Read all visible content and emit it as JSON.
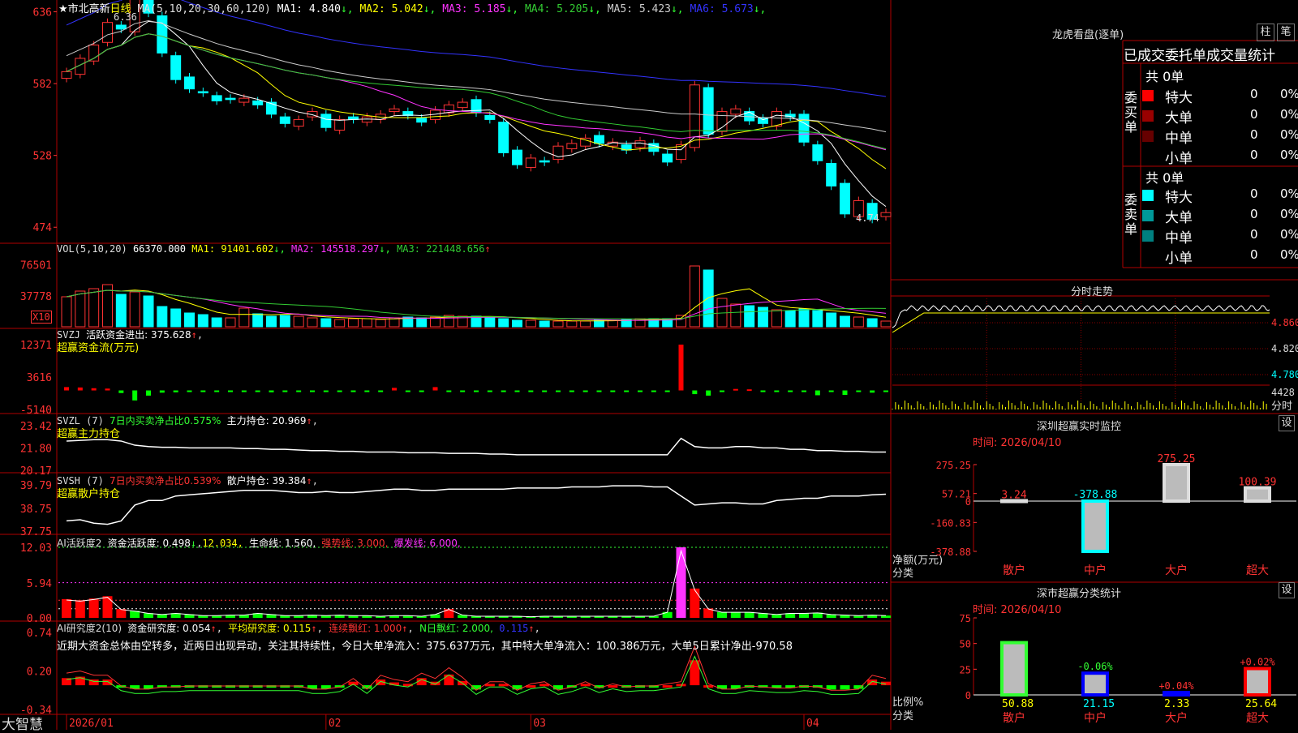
{
  "stock": {
    "title": "★市北高新",
    "period": "日线",
    "ma_label": "MA(5,10,20,30,60,120)",
    "ma": [
      {
        "name": "MA1:",
        "value": "4.840",
        "arrow": "↓",
        "color": "#ffffff"
      },
      {
        "name": "MA2:",
        "value": "5.042",
        "arrow": "↓",
        "color": "#ffff00"
      },
      {
        "name": "MA3:",
        "value": "5.185",
        "arrow": "↓",
        "color": "#ff33ff"
      },
      {
        "name": "MA4:",
        "value": "5.205",
        "arrow": "↓",
        "color": "#33cc33"
      },
      {
        "name": "MA5:",
        "value": "5.423",
        "arrow": "↓",
        "color": "#cccccc"
      },
      {
        "name": "MA6:",
        "value": "5.673",
        "arrow": "↓",
        "color": "#3333ff"
      }
    ],
    "high_label": "6.36",
    "low_label": "4.74",
    "y_ticks": [
      "636",
      "582",
      "528",
      "474"
    ],
    "x_labels": [
      "2026/01",
      "02",
      "03",
      "04"
    ],
    "brand": "大智慧"
  },
  "vol": {
    "label": "VOL(5,10,20)",
    "value": "66370.000",
    "items": [
      {
        "name": "MA1:",
        "value": "91401.602",
        "arrow": "↓",
        "color": "#ffff00"
      },
      {
        "name": "MA2:",
        "value": "145518.297",
        "arrow": "↓",
        "color": "#ff33ff"
      },
      {
        "name": "MA3:",
        "value": "221448.656",
        "arrow": "↑",
        "color": "#33cc33"
      }
    ],
    "y_ticks": [
      "76501",
      "37778"
    ],
    "unit": "X10"
  },
  "svzj": {
    "label": "SVZJ",
    "line1": "活跃资金进出: 375.628",
    "arrow": "↑",
    "line2": "超赢资金流(万元)",
    "y_ticks": [
      "12371",
      "3616",
      "-5140"
    ]
  },
  "svzl": {
    "label": "SVZL (7)",
    "text1": "7日内买卖净占比0.575%",
    "text2": "主力持仓: 20.969",
    "arrow": "↑",
    "line2": "超赢主力持仓",
    "y_ticks": [
      "23.42",
      "21.80",
      "20.17"
    ]
  },
  "svsh": {
    "label": "SVSH (7)",
    "text1": "7日内买卖净占比0.539%",
    "text2": "散户持仓: 39.384",
    "arrow": "↑",
    "line2": "超赢散户持仓",
    "y_ticks": [
      "39.79",
      "38.75",
      "37.75"
    ]
  },
  "ai1": {
    "label": "AI活跃度2",
    "t1": "资金活跃度: 0.498",
    "t2": "12.034,",
    "t3": "生命线: 1.560,",
    "t4": "强势线: 3.000,",
    "t5": "爆发线: 6.000,",
    "y_ticks": [
      "12.03",
      "5.94",
      "0.00"
    ]
  },
  "ai2": {
    "label": "AI研究度2(10)",
    "t1": "资金研究度: 0.054",
    "t2": "平均研究度: 0.115",
    "t3": "连续飘红: 1.000",
    "t4": "N日飘红: 2.000,",
    "t5": "0.115",
    "comment": "近期大资金总体由空转多，近两日出现异动，关注其持续性，今日大单净流入：375.637万元，其中特大单净流入：100.386万元，大单5日累计净出-970.58",
    "y_ticks": [
      "0.74",
      "0.20",
      "-0.34"
    ]
  },
  "dragon": {
    "title": "龙虎看盘(逐单)",
    "btn1": "柱",
    "btn2": "笔",
    "header": "已成交委托单成交量统计",
    "buy_label": "委买单",
    "sell_label": "委卖单",
    "buy_total": "共 0单",
    "sell_total": "共 0单",
    "rows": [
      {
        "name": "特大",
        "count": "0",
        "pct": "0%"
      },
      {
        "name": "大单",
        "count": "0",
        "pct": "0%"
      },
      {
        "name": "中单",
        "count": "0",
        "pct": "0%"
      },
      {
        "name": "小单",
        "count": "0",
        "pct": "0%"
      }
    ],
    "buy_colors": [
      "#ff0000",
      "#990000",
      "#660000",
      ""
    ],
    "sell_colors": [
      "#00ffff",
      "#009999",
      "#008080",
      ""
    ]
  },
  "intraday": {
    "title": "分时走势",
    "y_ticks": [
      "4.860",
      "4.820",
      "4.780"
    ],
    "vol_tick": "4428",
    "vol_unit": "分时"
  },
  "sz_monitor": {
    "title": "深圳超赢实时监控",
    "button": "设",
    "time": "时间: 2026/04/10",
    "y_ticks": [
      "275.25",
      "57.21",
      "0",
      "-160.83",
      "-378.88"
    ],
    "ylabel1": "净额(万元)",
    "ylabel2": "分类",
    "chart_data": {
      "type": "bar",
      "categories": [
        "散户",
        "中户",
        "大户",
        "超大"
      ],
      "values": [
        3.24,
        -378.88,
        275.25,
        100.39
      ],
      "value_labels": [
        "3.24",
        "-378.88",
        "275.25",
        "100.39"
      ],
      "ylim": [
        -378.88,
        275.25
      ],
      "colors": [
        "#dddddd",
        "#00ffff",
        "#dddddd",
        "#dddddd"
      ]
    }
  },
  "sh_stats": {
    "title": "深市超赢分类统计",
    "button": "设",
    "time": "时间: 2026/04/10",
    "y_ticks": [
      "75",
      "50",
      "25",
      "0"
    ],
    "ylabel1": "比例%",
    "ylabel2": "分类",
    "chart_data": {
      "type": "bar",
      "categories": [
        "散户",
        "中户",
        "大户",
        "超大"
      ],
      "values": [
        50.88,
        21.15,
        2.33,
        25.64
      ],
      "value_labels": [
        "50.88",
        "21.15",
        "2.33",
        "25.64"
      ],
      "change_labels": [
        "",
        "-0.06%",
        "+0.04%",
        "+0.02%"
      ],
      "ylim": [
        0,
        75
      ],
      "colors": [
        "#33ff33",
        "#0000ff",
        "#0000ff",
        "#ff0000"
      ]
    }
  },
  "chart_data": {
    "type": "candlestick",
    "x_labels": [
      "2026/01",
      "02",
      "03",
      "04"
    ],
    "ylim": [
      465,
      640
    ],
    "close": [
      591,
      601,
      611,
      628,
      623,
      647,
      635,
      605,
      585,
      578,
      575,
      569,
      570,
      571,
      566,
      559,
      552,
      555,
      561,
      549,
      555,
      555,
      557,
      559,
      563,
      558,
      553,
      562,
      566,
      568,
      560,
      555,
      530,
      521,
      526,
      523,
      535,
      537,
      541,
      537,
      538,
      532,
      539,
      531,
      523,
      536,
      581,
      544,
      561,
      563,
      554,
      552,
      561,
      557,
      538,
      524,
      505,
      484,
      494,
      480,
      485
    ],
    "volume": [
      37000,
      44000,
      47000,
      52000,
      40000,
      43000,
      38000,
      25000,
      22000,
      17000,
      15000,
      11000,
      11000,
      23000,
      16000,
      13000,
      14000,
      13000,
      11000,
      10000,
      9000,
      10000,
      10000,
      9000,
      11000,
      12000,
      11000,
      12000,
      14000,
      13000,
      13000,
      12000,
      10000,
      8000,
      8000,
      7000,
      7000,
      7000,
      7000,
      8000,
      8000,
      9000,
      10000,
      10000,
      10000,
      14000,
      75000,
      70000,
      35000,
      28000,
      26000,
      24000,
      21000,
      20000,
      22000,
      20000,
      17000,
      13000,
      12000,
      10000,
      7000
    ],
    "net_flow": [
      900,
      800,
      600,
      500,
      -700,
      -2700,
      -1400,
      -600,
      -500,
      -300,
      -400,
      -300,
      -300,
      -400,
      -300,
      -500,
      -300,
      -300,
      -400,
      -300,
      -300,
      -300,
      -300,
      -300,
      700,
      -300,
      -300,
      900,
      -400,
      -300,
      -300,
      -300,
      -300,
      -300,
      -300,
      -300,
      -300,
      -300,
      -300,
      -300,
      -300,
      -300,
      -300,
      -300,
      -300,
      12371,
      -1000,
      -1400,
      -300,
      400,
      300,
      -300,
      -300,
      -300,
      -300,
      -1300,
      -300,
      -1200,
      -300,
      -600,
      -300
    ],
    "main_hold": [
      22.3,
      22.35,
      22.4,
      22.4,
      22.3,
      22.0,
      21.9,
      21.85,
      21.85,
      21.8,
      21.8,
      21.8,
      21.8,
      21.75,
      21.75,
      21.7,
      21.7,
      21.65,
      21.6,
      21.6,
      21.55,
      21.55,
      21.5,
      21.5,
      21.5,
      21.45,
      21.45,
      21.45,
      21.4,
      21.4,
      21.4,
      21.35,
      21.35,
      21.3,
      21.3,
      21.3,
      21.3,
      21.3,
      21.3,
      21.3,
      21.3,
      21.3,
      21.3,
      21.3,
      21.3,
      22.5,
      21.9,
      21.8,
      21.8,
      21.9,
      21.9,
      21.8,
      21.8,
      21.7,
      21.7,
      21.6,
      21.6,
      21.55,
      21.55,
      21.5,
      21.5
    ],
    "retail_hold": [
      38.2,
      38.25,
      38.1,
      38.05,
      38.2,
      38.9,
      39.1,
      39.1,
      39.3,
      39.35,
      39.4,
      39.45,
      39.5,
      39.55,
      39.55,
      39.55,
      39.5,
      39.45,
      39.45,
      39.5,
      39.45,
      39.45,
      39.5,
      39.55,
      39.6,
      39.6,
      39.55,
      39.55,
      39.6,
      39.6,
      39.6,
      39.6,
      39.6,
      39.65,
      39.65,
      39.65,
      39.65,
      39.7,
      39.7,
      39.7,
      39.75,
      39.75,
      39.75,
      39.7,
      39.7,
      39.3,
      38.9,
      38.95,
      39.0,
      39.0,
      38.95,
      38.95,
      39.1,
      39.15,
      39.2,
      39.2,
      39.3,
      39.3,
      39.3,
      39.35,
      39.38
    ],
    "activity": [
      3.2,
      3.0,
      3.3,
      3.7,
      1.5,
      1.2,
      0.8,
      0.6,
      0.8,
      0.6,
      0.4,
      0.4,
      0.5,
      0.5,
      0.8,
      0.6,
      0.4,
      0.4,
      0.5,
      0.4,
      0.5,
      0.4,
      0.4,
      0.3,
      0.4,
      0.4,
      0.3,
      0.6,
      1.5,
      0.5,
      0.3,
      0.3,
      0.3,
      0.3,
      0.2,
      0.3,
      0.3,
      0.3,
      0.3,
      0.3,
      0.3,
      0.3,
      0.3,
      0.3,
      1.0,
      12.03,
      5.0,
      1.6,
      1.0,
      1.0,
      1.0,
      0.8,
      0.6,
      0.8,
      0.8,
      0.9,
      0.6,
      0.5,
      0.4,
      0.5,
      0.4
    ],
    "research": [
      0.1,
      0.12,
      0.08,
      0.08,
      -0.02,
      -0.05,
      -0.05,
      -0.03,
      -0.03,
      -0.02,
      -0.02,
      -0.02,
      -0.02,
      -0.02,
      -0.02,
      -0.02,
      -0.02,
      -0.02,
      -0.05,
      -0.05,
      -0.03,
      0.05,
      -0.05,
      0.08,
      0.04,
      0.02,
      0.1,
      0.05,
      0.15,
      0.06,
      -0.06,
      0.02,
      0.02,
      -0.06,
      0.0,
      0.02,
      -0.06,
      -0.03,
      0.02,
      -0.04,
      0.0,
      -0.03,
      -0.02,
      -0.02,
      0.0,
      0.02,
      0.35,
      0.0,
      -0.05,
      -0.05,
      -0.02,
      -0.03,
      -0.04,
      -0.04,
      -0.02,
      -0.03,
      -0.06,
      -0.06,
      -0.05,
      0.08,
      0.05
    ]
  }
}
